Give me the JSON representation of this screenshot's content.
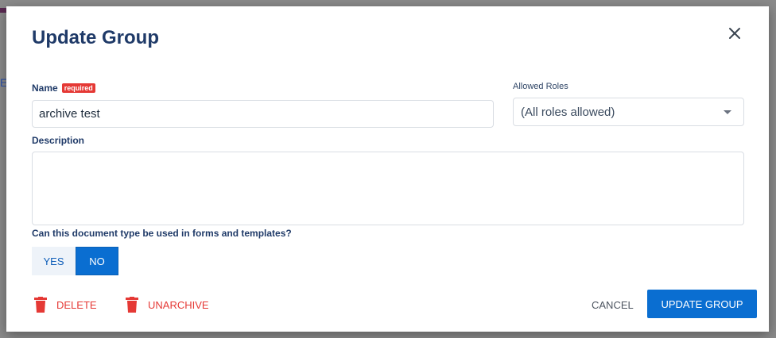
{
  "backdrop": {
    "partial_text": "E"
  },
  "dialog": {
    "title": "Update Group",
    "close_icon": "close-icon",
    "name": {
      "label": "Name",
      "required_badge": "required",
      "value": "archive test"
    },
    "allowed_roles": {
      "label": "Allowed Roles",
      "selected": "(All roles allowed)"
    },
    "description": {
      "label": "Description",
      "value": ""
    },
    "forms_question": {
      "label": "Can this document type be used in forms and templates?",
      "options": [
        "YES",
        "NO"
      ],
      "selected": "NO"
    },
    "actions": {
      "delete_label": "DELETE",
      "unarchive_label": "UNARCHIVE",
      "cancel_label": "CANCEL",
      "submit_label": "UPDATE GROUP",
      "delete_icon": "trash-icon",
      "unarchive_icon": "trash-icon"
    }
  },
  "colors": {
    "primary": "#0a6ed1",
    "danger": "#e53935",
    "title": "#1f3a68"
  }
}
